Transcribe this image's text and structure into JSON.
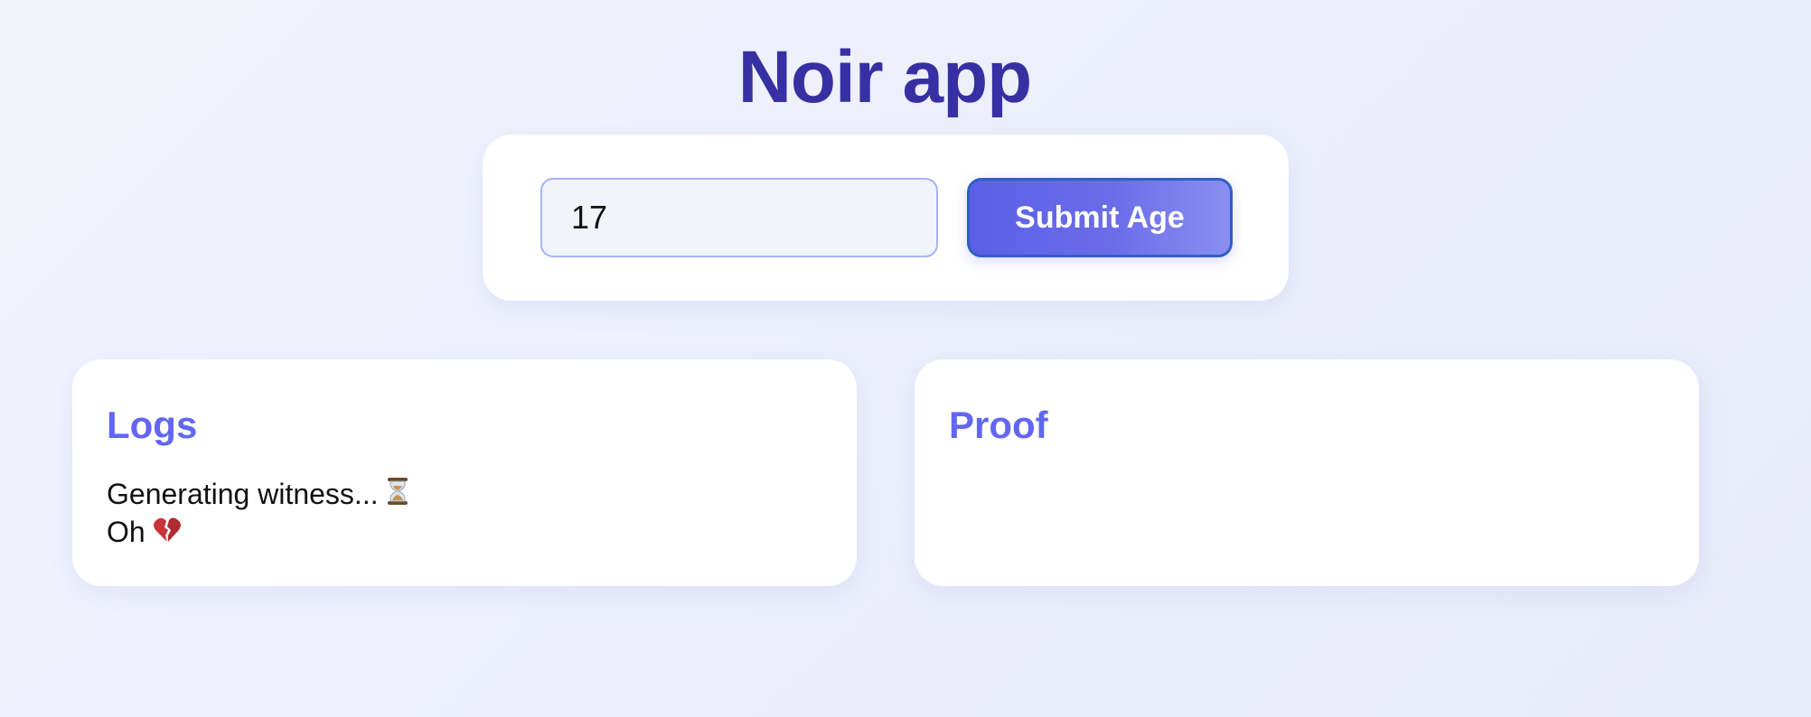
{
  "page": {
    "title": "Noir app"
  },
  "form": {
    "age_value": "17",
    "submit_label": "Submit Age"
  },
  "logs": {
    "heading": "Logs",
    "entries": [
      {
        "text": "Generating witness...",
        "icon": "hourglass-icon"
      },
      {
        "text": "Oh",
        "icon": "broken-heart-icon"
      }
    ]
  },
  "proof": {
    "heading": "Proof"
  },
  "colors": {
    "title": "#3730a3",
    "accent": "#6366f1",
    "button_border": "#2f5fc4",
    "input_bg": "#f1f4fa",
    "input_border": "#a5b4fc"
  }
}
